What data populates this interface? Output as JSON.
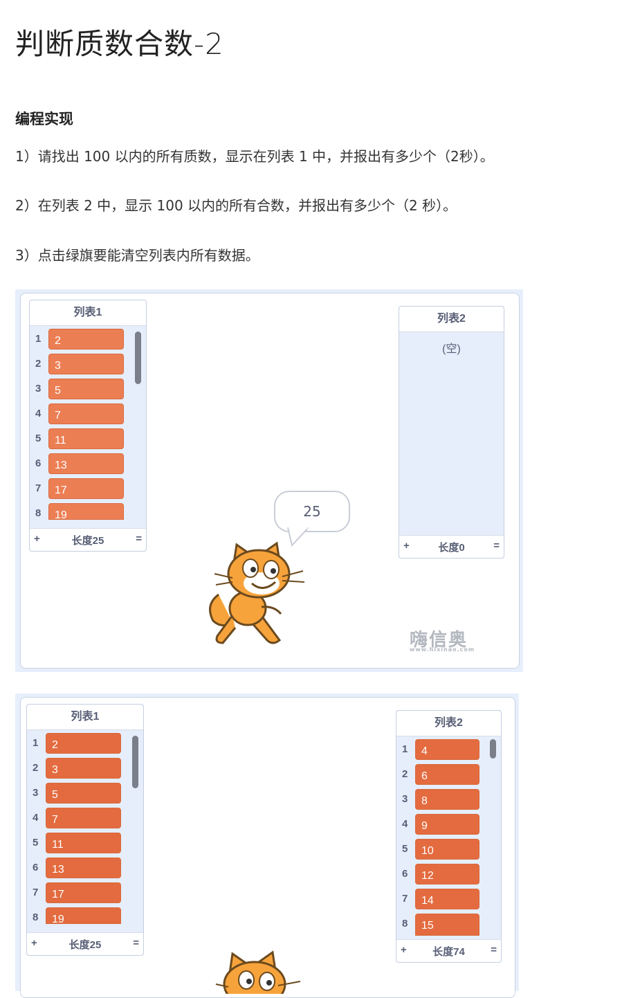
{
  "page": {
    "title": "判断质数合数-2",
    "subheading": "编程实现",
    "steps": [
      "1）请找出 100 以内的所有质数，显示在列表 1 中，并报出有多少个（2秒）。",
      "2）在列表 2 中，显示 100 以内的所有合数，并报出有多少个（2 秒）。",
      "3）点击绿旗要能清空列表内所有数据。"
    ]
  },
  "stage1": {
    "list1": {
      "title": "列表1",
      "indices": [
        "1",
        "2",
        "3",
        "4",
        "5",
        "6",
        "7",
        "8"
      ],
      "items": [
        "2",
        "3",
        "5",
        "7",
        "11",
        "13",
        "17",
        "19"
      ],
      "add": "+",
      "length": "长度25",
      "resize": "="
    },
    "list2": {
      "title": "列表2",
      "empty": "(空)",
      "add": "+",
      "length": "长度0",
      "resize": "="
    },
    "speech": "25",
    "watermark": "嗨信奥",
    "watermark_url": "www.hixinao.com"
  },
  "stage2": {
    "list1": {
      "title": "列表1",
      "indices": [
        "1",
        "2",
        "3",
        "4",
        "5",
        "6",
        "7",
        "8"
      ],
      "items": [
        "2",
        "3",
        "5",
        "7",
        "11",
        "13",
        "17",
        "19"
      ],
      "add": "+",
      "length": "长度25",
      "resize": "="
    },
    "list2": {
      "title": "列表2",
      "indices": [
        "1",
        "2",
        "3",
        "4",
        "5",
        "6",
        "7",
        "8"
      ],
      "items": [
        "4",
        "6",
        "8",
        "9",
        "10",
        "12",
        "14",
        "15"
      ],
      "add": "+",
      "length": "长度74",
      "resize": "="
    }
  },
  "colors": {
    "list_item": "#ec7e54",
    "list_bg": "#e6eefb",
    "stage_border": "#c9d2e3",
    "cat_orange": "#f7a33b"
  }
}
